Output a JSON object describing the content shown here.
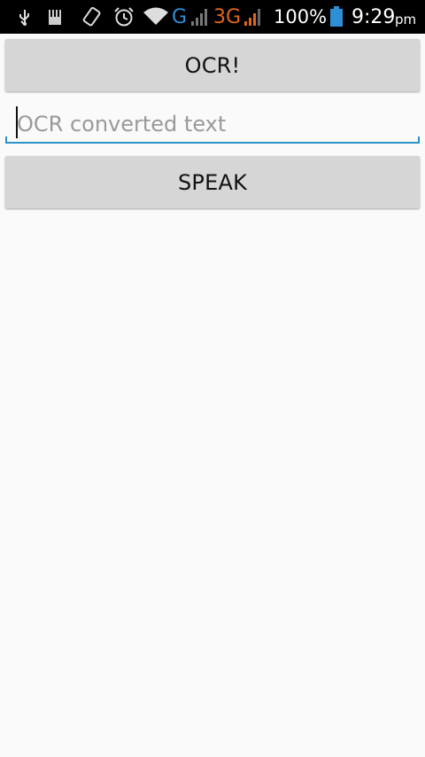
{
  "status_bar": {
    "network_g": "G",
    "network_3g": "3G",
    "battery": "100%",
    "time": "9:29",
    "ampm": "pm",
    "icons": [
      "usb-icon",
      "sd-card-icon",
      "rotate-icon",
      "alarm-icon",
      "wifi-icon",
      "signal-icon",
      "signal-3g-icon",
      "battery-icon"
    ],
    "colors": {
      "g": "#2f8fd6",
      "three_g": "#e0661c",
      "battery": "#2f8fd6"
    }
  },
  "main": {
    "ocr_button_label": "OCR!",
    "text_field": {
      "value": "",
      "placeholder": "OCR converted text"
    },
    "speak_button_label": "SPEAK"
  }
}
